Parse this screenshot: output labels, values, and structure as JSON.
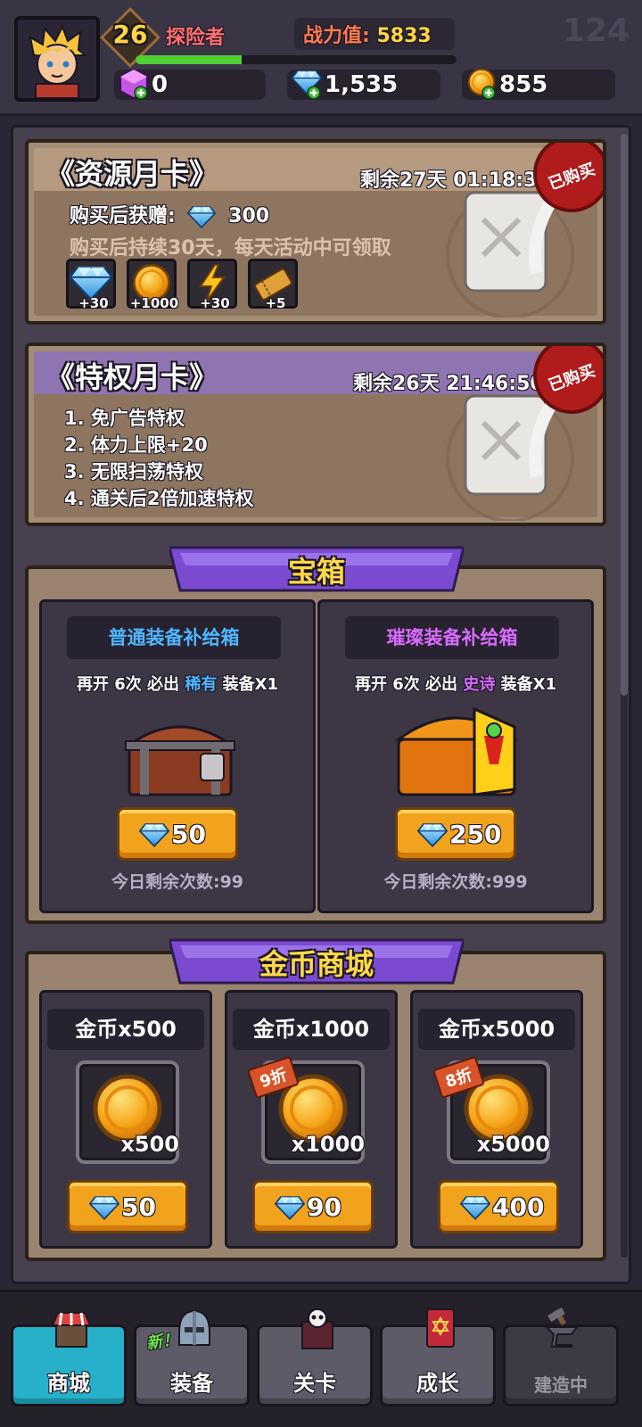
{
  "header": {
    "level": "26",
    "player_name": "探险者",
    "power_label": "战力值:",
    "power_value": "5833",
    "ghost_number": "124",
    "xp_progress": 0.33,
    "currencies": [
      {
        "icon": "purple-gem-icon",
        "value": "0"
      },
      {
        "icon": "diamond-icon",
        "value": "1,535"
      },
      {
        "icon": "gold-coin-icon",
        "value": "855"
      }
    ]
  },
  "resource_card": {
    "title": "《资源月卡》",
    "timer": "剩余27天 01:18:31",
    "stamp": "已购买",
    "bonus_label": "购买后获赠:",
    "bonus_amount": "300",
    "description": "购买后持续30天，每天活动中可领取",
    "rewards": [
      {
        "icon": "diamond-icon",
        "amount": "+30"
      },
      {
        "icon": "gold-coin-icon",
        "amount": "+1000"
      },
      {
        "icon": "energy-bolt-icon",
        "amount": "+30"
      },
      {
        "icon": "ticket-icon",
        "amount": "+5"
      }
    ]
  },
  "privilege_card": {
    "title": "《特权月卡》",
    "timer": "剩余26天 21:46:50",
    "stamp": "已购买",
    "perks": [
      "1. 免广告特权",
      "2. 体力上限+20",
      "3. 无限扫荡特权",
      "4. 通关后2倍加速特权"
    ]
  },
  "chest_section": {
    "banner": "宝箱",
    "chests": [
      {
        "title": "普通装备补给箱",
        "hint_prefix": "再开 6次 必出",
        "rarity": "稀有",
        "hint_suffix": "装备X1",
        "price": "50",
        "remaining": "今日剩余次数:99"
      },
      {
        "title": "璀璨装备补给箱",
        "hint_prefix": "再开 6次 必出",
        "rarity": "史诗",
        "hint_suffix": "装备X1",
        "price": "250",
        "remaining": "今日剩余次数:999"
      }
    ]
  },
  "coin_shop": {
    "banner": "金币商城",
    "items": [
      {
        "title": "金币x500",
        "qty": "x500",
        "discount": "",
        "price": "50"
      },
      {
        "title": "金币x1000",
        "qty": "x1000",
        "discount": "9折",
        "price": "90"
      },
      {
        "title": "金币x5000",
        "qty": "x5000",
        "discount": "8折",
        "price": "400"
      }
    ]
  },
  "nav": {
    "tabs": [
      {
        "label": "商城",
        "icon": "shop-icon"
      },
      {
        "label": "装备",
        "icon": "helmet-icon"
      },
      {
        "label": "关卡",
        "icon": "skull-gate-icon"
      },
      {
        "label": "成长",
        "icon": "spellbook-icon"
      },
      {
        "label": "建造中",
        "icon": "anvil-icon"
      }
    ],
    "new_tag": "新！"
  },
  "colors": {
    "accent_gold": "#ffd84a",
    "diamond": "#4fc3ff",
    "banner_purple": "#7a4bd0",
    "active_tab": "#27b0c9",
    "rare_blue": "#4fb6ff",
    "epic_purple": "#d86bff"
  }
}
